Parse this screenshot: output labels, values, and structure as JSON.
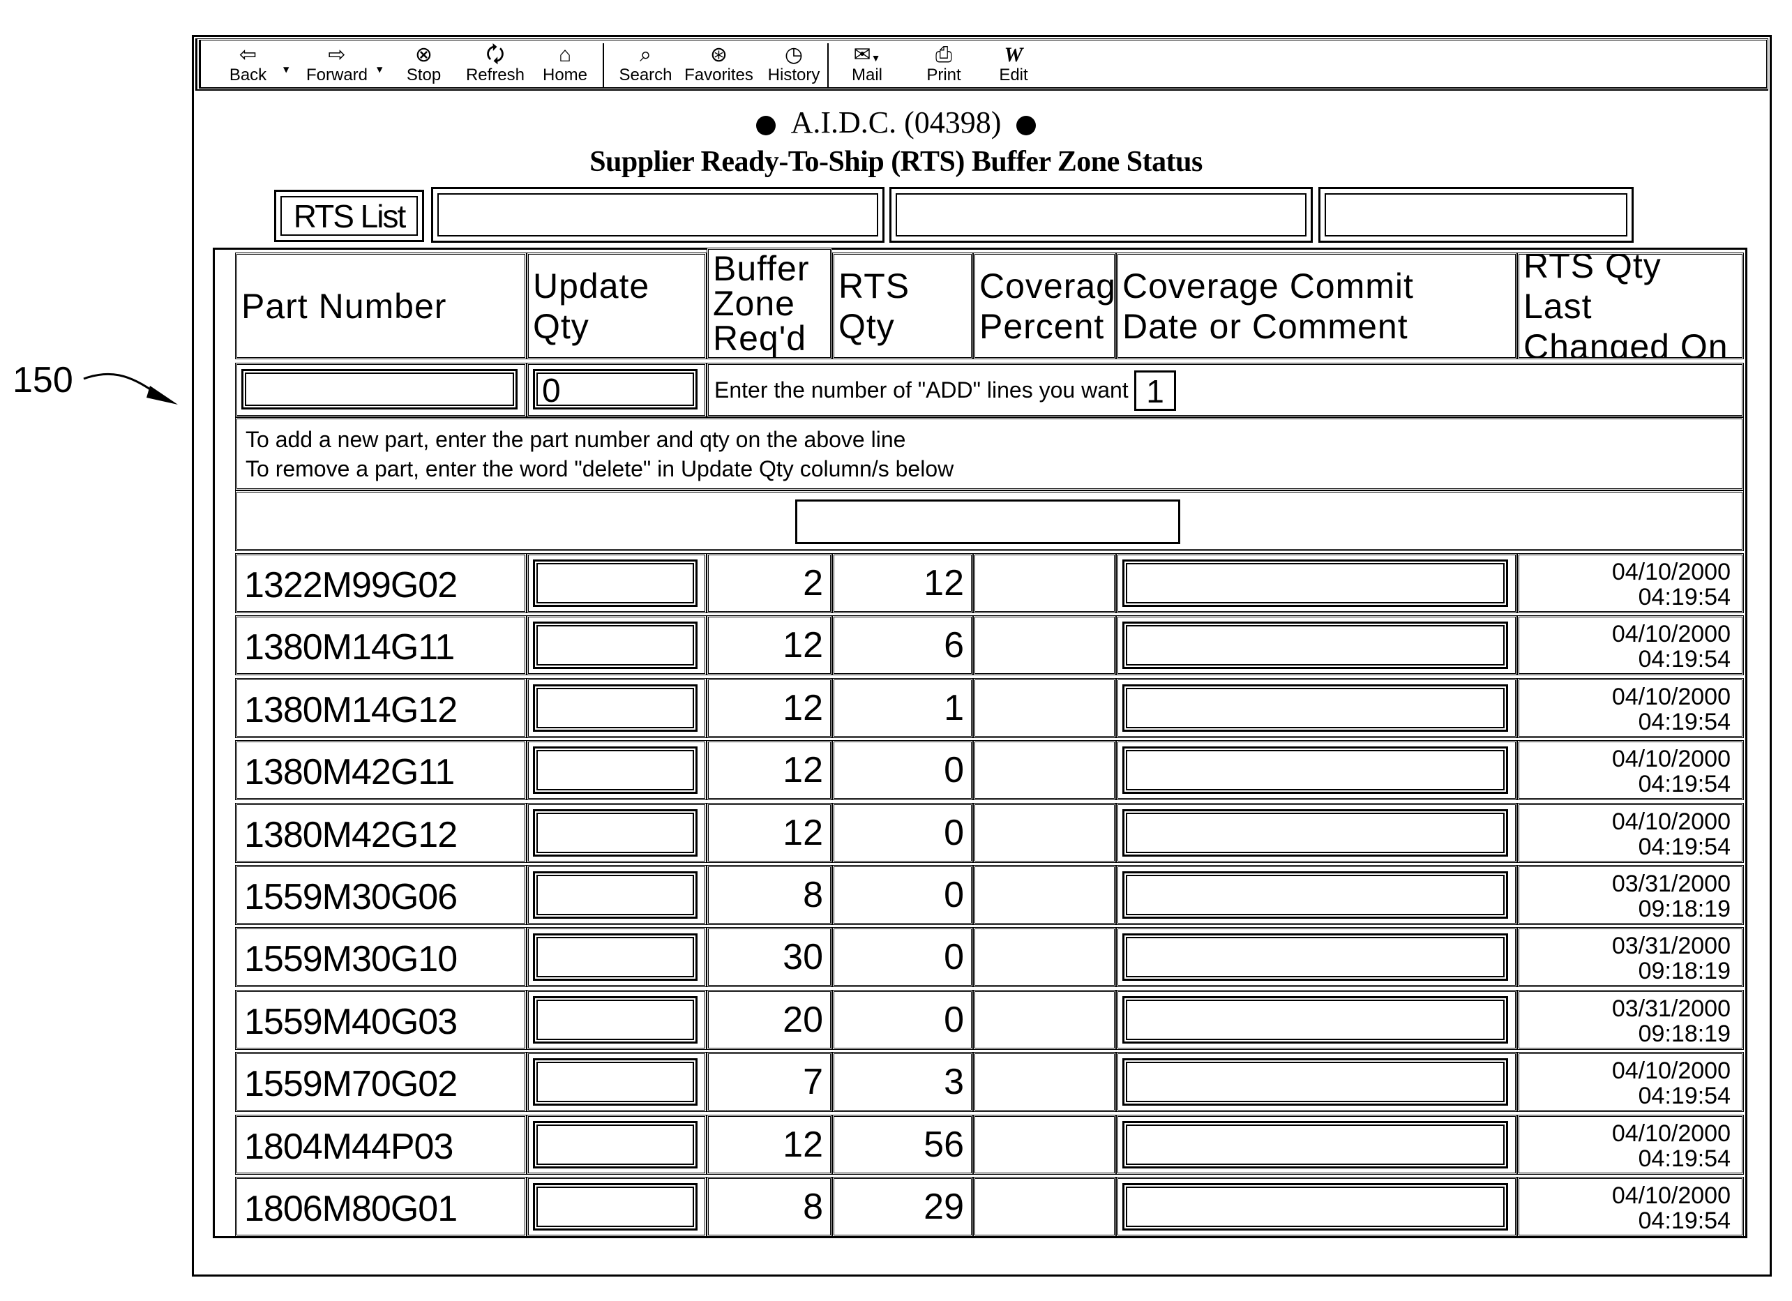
{
  "reference_label": "150",
  "toolbar": {
    "buttons": [
      {
        "label": "Back",
        "icon": "back-arrow-icon"
      },
      {
        "label": "Forward",
        "icon": "forward-arrow-icon"
      },
      {
        "label": "Stop",
        "icon": "stop-icon"
      },
      {
        "label": "Refresh",
        "icon": "refresh-icon"
      },
      {
        "label": "Home",
        "icon": "home-icon"
      },
      {
        "label": "Search",
        "icon": "search-icon"
      },
      {
        "label": "Favorites",
        "icon": "favorites-icon"
      },
      {
        "label": "History",
        "icon": "history-icon"
      },
      {
        "label": "Mail",
        "icon": "mail-icon"
      },
      {
        "label": "Print",
        "icon": "print-icon"
      },
      {
        "label": "Edit",
        "icon": "edit-icon"
      }
    ]
  },
  "page": {
    "org_title": "A.I.D.C. (04398)",
    "subtitle": "Supplier Ready-To-Ship (RTS) Buffer Zone Status",
    "rts_list_button": "RTS List",
    "top_fields": [
      "",
      "",
      ""
    ]
  },
  "table": {
    "headers": {
      "part_number": "Part Number",
      "update_qty": "Update Qty",
      "buffer_zone_1": "Buffer",
      "buffer_zone_2": "Zone",
      "buffer_zone_3": "Req'd",
      "rts_qty": "RTS Qty",
      "coverage_1": "Coverage",
      "coverage_2": "Percent",
      "commit_1": "Coverage Commit",
      "commit_2": "Date or Comment",
      "changed_1": "RTS Qty Last",
      "changed_2": "Changed On"
    },
    "add_row": {
      "part_number_value": "",
      "update_qty_value": "0",
      "add_lines_label": "Enter the number of \"ADD\" lines you want",
      "add_lines_value": "1"
    },
    "instructions": [
      "To add a new part, enter the part number and qty on the above line",
      "To remove a part, enter the word \"delete\" in Update Qty column/s below"
    ],
    "blank_field_value": "",
    "rows": [
      {
        "part": "1322M99G02",
        "update_qty": "",
        "buffer_zone_reqd": "2",
        "rts_qty": "12",
        "coverage_percent": "",
        "commit": "",
        "changed_date": "04/10/2000",
        "changed_time": "04:19:54"
      },
      {
        "part": "1380M14G11",
        "update_qty": "",
        "buffer_zone_reqd": "12",
        "rts_qty": "6",
        "coverage_percent": "",
        "commit": "",
        "changed_date": "04/10/2000",
        "changed_time": "04:19:54"
      },
      {
        "part": "1380M14G12",
        "update_qty": "",
        "buffer_zone_reqd": "12",
        "rts_qty": "1",
        "coverage_percent": "",
        "commit": "",
        "changed_date": "04/10/2000",
        "changed_time": "04:19:54"
      },
      {
        "part": "1380M42G11",
        "update_qty": "",
        "buffer_zone_reqd": "12",
        "rts_qty": "0",
        "coverage_percent": "",
        "commit": "",
        "changed_date": "04/10/2000",
        "changed_time": "04:19:54"
      },
      {
        "part": "1380M42G12",
        "update_qty": "",
        "buffer_zone_reqd": "12",
        "rts_qty": "0",
        "coverage_percent": "",
        "commit": "",
        "changed_date": "04/10/2000",
        "changed_time": "04:19:54"
      },
      {
        "part": "1559M30G06",
        "update_qty": "",
        "buffer_zone_reqd": "8",
        "rts_qty": "0",
        "coverage_percent": "",
        "commit": "",
        "changed_date": "03/31/2000",
        "changed_time": "09:18:19"
      },
      {
        "part": "1559M30G10",
        "update_qty": "",
        "buffer_zone_reqd": "30",
        "rts_qty": "0",
        "coverage_percent": "",
        "commit": "",
        "changed_date": "03/31/2000",
        "changed_time": "09:18:19"
      },
      {
        "part": "1559M40G03",
        "update_qty": "",
        "buffer_zone_reqd": "20",
        "rts_qty": "0",
        "coverage_percent": "",
        "commit": "",
        "changed_date": "03/31/2000",
        "changed_time": "09:18:19"
      },
      {
        "part": "1559M70G02",
        "update_qty": "",
        "buffer_zone_reqd": "7",
        "rts_qty": "3",
        "coverage_percent": "",
        "commit": "",
        "changed_date": "04/10/2000",
        "changed_time": "04:19:54"
      },
      {
        "part": "1804M44P03",
        "update_qty": "",
        "buffer_zone_reqd": "12",
        "rts_qty": "56",
        "coverage_percent": "",
        "commit": "",
        "changed_date": "04/10/2000",
        "changed_time": "04:19:54"
      },
      {
        "part": "1806M80G01",
        "update_qty": "",
        "buffer_zone_reqd": "8",
        "rts_qty": "29",
        "coverage_percent": "",
        "commit": "",
        "changed_date": "04/10/2000",
        "changed_time": "04:19:54"
      }
    ]
  }
}
